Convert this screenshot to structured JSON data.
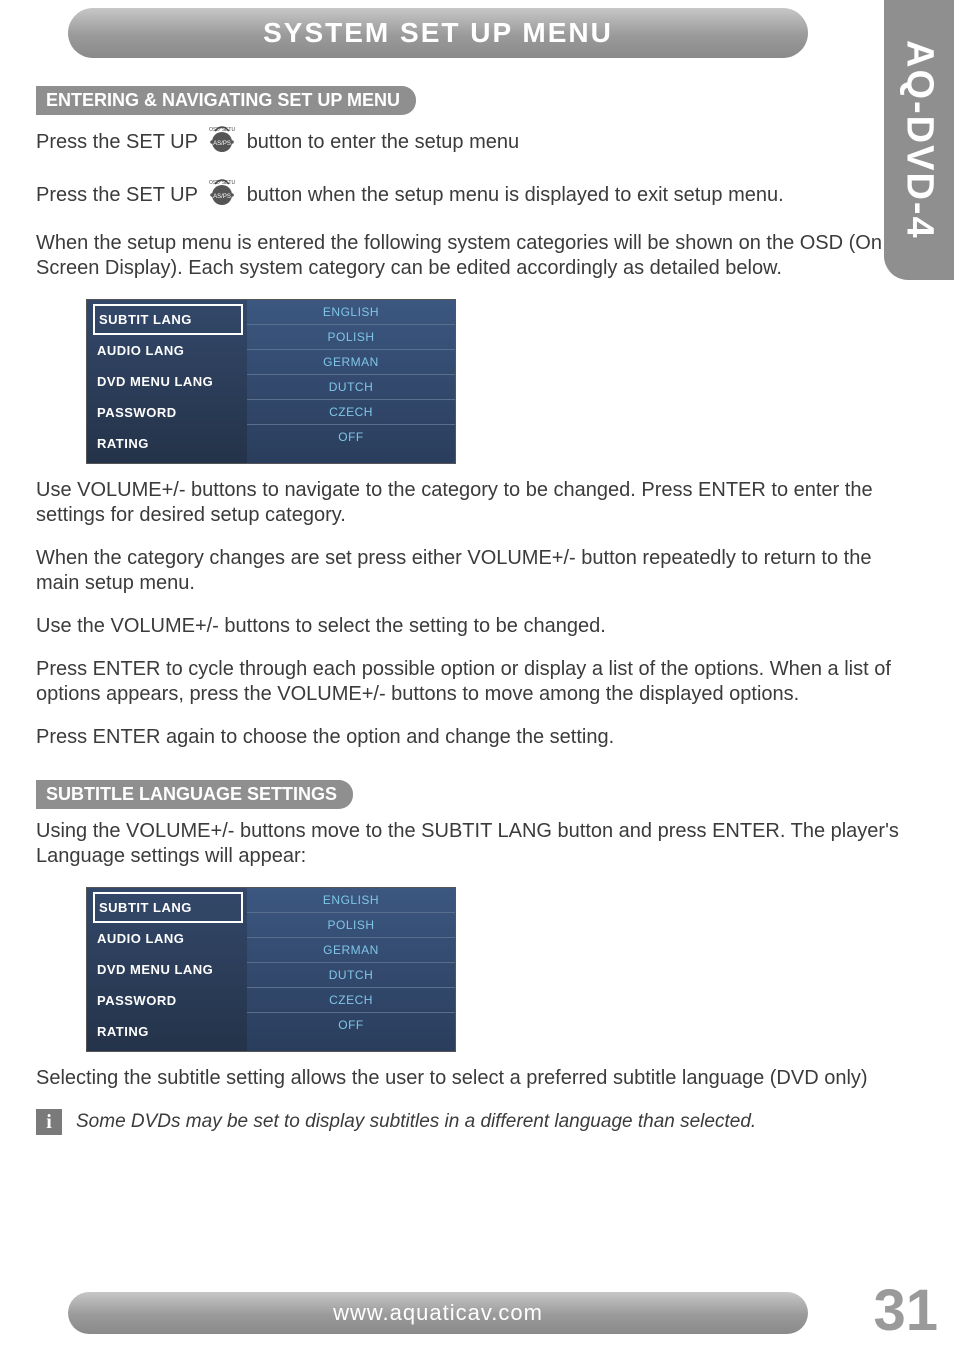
{
  "side_tab": "AQ-DVD-4",
  "header": "SYSTEM SET UP MENU",
  "section1": {
    "title": "ENTERING & NAVIGATING SET UP MENU",
    "p1a": "Press the SET UP",
    "p1b": "button to enter the setup menu",
    "p2a": "Press the SET UP",
    "p2b": "button when the setup menu is displayed to exit setup menu.",
    "p3": "When the setup menu is entered the following system categories will be shown on the OSD (On Screen Display).  Each system category can be edited accordingly as detailed below.",
    "osd_left": [
      "SUBTIT LANG",
      "AUDIO LANG",
      "DVD MENU LANG",
      "PASSWORD",
      "RATING"
    ],
    "osd_right": [
      "ENGLISH",
      "POLISH",
      "GERMAN",
      "DUTCH",
      "CZECH",
      "OFF"
    ],
    "p4": "Use VOLUME+/- buttons to navigate to the category to be changed. Press ENTER to enter the settings for desired setup category.",
    "p5": "When the category changes are set press either VOLUME+/- button repeatedly to return to the main setup menu.",
    "p6": "Use the VOLUME+/- buttons to select the setting to be changed.",
    "p7": "Press ENTER to cycle through each possible option or display a list of the options. When a list of options appears, press the VOLUME+/- buttons to move among the displayed options.",
    "p8": "Press ENTER again to choose the option and change the setting."
  },
  "section2": {
    "title": "SUBTITLE LANGUAGE SETTINGS",
    "p1": "Using the VOLUME+/- buttons move to the SUBTIT LANG button and press ENTER. The player's Language settings will appear:",
    "osd_left": [
      "SUBTIT LANG",
      "AUDIO LANG",
      "DVD MENU LANG",
      "PASSWORD",
      "RATING"
    ],
    "osd_right": [
      "ENGLISH",
      "POLISH",
      "GERMAN",
      "DUTCH",
      "CZECH",
      "OFF"
    ],
    "p2": "Selecting the subtitle setting allows the user to select a preferred subtitle language (DVD only)",
    "info": "Some DVDs may be set to display subtitles in a different language than selected."
  },
  "footer": "www.aquaticav.com",
  "page_number": "31",
  "icon_label": "AS/PS"
}
